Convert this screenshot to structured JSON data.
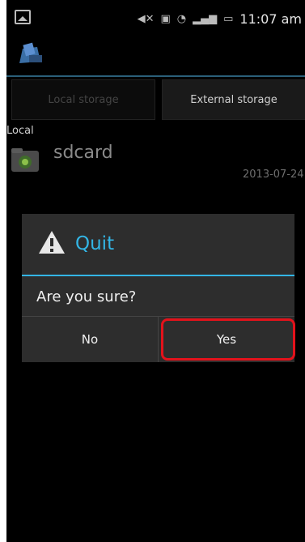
{
  "status_bar": {
    "time": "11:07 am",
    "icons": [
      "image-notification-icon",
      "mute-icon",
      "sim-icon",
      "wifi-icon",
      "signal-icon",
      "battery-icon"
    ]
  },
  "app_bar": {
    "logo_icon": "file-manager-logo"
  },
  "tabs": [
    {
      "label": "Local storage",
      "state": "selected"
    },
    {
      "label": "External storage",
      "state": "normal"
    }
  ],
  "local_section": {
    "label": "Local",
    "items": [
      {
        "name": "sdcard",
        "date": "2013-07-24",
        "icon": "folder-icon"
      }
    ]
  },
  "dialog": {
    "title": "Quit",
    "icon": "warning-icon",
    "message": "Are you sure?",
    "buttons": {
      "no": "No",
      "yes": "Yes"
    },
    "accent": "#33b5e5",
    "highlight_color": "#e3121b"
  }
}
